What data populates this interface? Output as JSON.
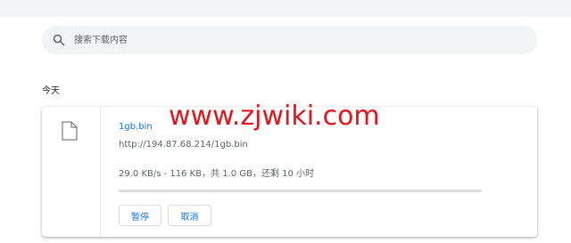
{
  "search": {
    "placeholder": "搜索下载内容"
  },
  "section": {
    "date_label": "今天"
  },
  "download": {
    "filename": "1gb.bin",
    "url": "http://194.87.68.214/1gb.bin",
    "status": "29.0 KB/s - 116 KB，共 1.0 GB，还剩 10 小时",
    "progress": 0.0001,
    "pause_label": "暂停",
    "cancel_label": "取消"
  },
  "watermark": {
    "text": "www.zjwiki.com"
  },
  "colors": {
    "accent": "#1a73e8",
    "watermark": "#e8121a",
    "search_bg": "#f1f3f4"
  },
  "icons": {
    "search": "search-icon",
    "file": "file-icon"
  }
}
